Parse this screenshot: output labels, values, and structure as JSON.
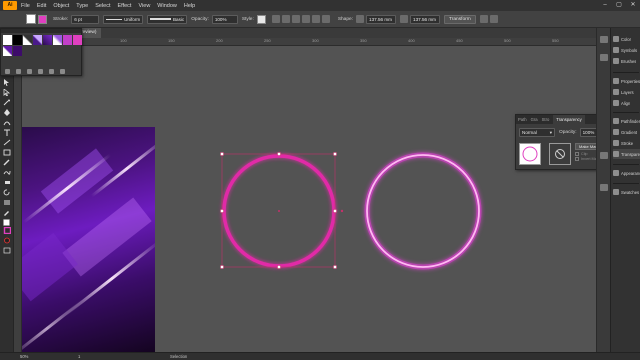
{
  "app": {
    "logo_text": "Ai"
  },
  "menu": {
    "items": [
      "File",
      "Edit",
      "Object",
      "Type",
      "Select",
      "Effect",
      "View",
      "Window",
      "Help"
    ],
    "window_controls": [
      "–",
      "▢",
      "✕"
    ]
  },
  "control_bar": {
    "stroke_label": "Stroke:",
    "stroke_weight": "6 pt",
    "profile": "Uniform",
    "brush": "Basic",
    "opacity_label": "Opacity:",
    "opacity_value": "100%",
    "style_label": "Style:",
    "shape_label": "Shape:",
    "width_value": "137.56 mm",
    "height_value": "137.56 mm",
    "transform_label": "Transform",
    "fill_color": "#ffffff",
    "stroke_color": "#e040c0"
  },
  "document_tab": {
    "label": "review)"
  },
  "ruler": {
    "top_ticks": [
      "0",
      "50",
      "100",
      "150",
      "200",
      "250",
      "300",
      "350",
      "400",
      "450",
      "500",
      "550"
    ]
  },
  "canvas": {
    "background": "#535353",
    "shape1_stroke": "#e12aa7",
    "shape2_stroke": "#ffb8f2",
    "glow_color": "#ff3cf0"
  },
  "transparency_panel": {
    "tabs": [
      "Path",
      "Gra",
      "Stro",
      "Transparency"
    ],
    "blend_mode": "Normal",
    "opacity_label": "Opacity:",
    "opacity_value": "100%",
    "make_mask_label": "Make Mask",
    "clip_label": "Clip",
    "invert_mask_label": "Invert Mask"
  },
  "right_dock": {
    "group1": [
      "Color",
      "Symbols",
      "Brushes"
    ],
    "group2": [
      "Properties",
      "Layers",
      "Align"
    ],
    "group3": [
      "Pathfinder",
      "Gradient",
      "Stroke",
      "Transparency"
    ],
    "group4": [
      "Appearance"
    ],
    "group5": [
      "Swatches"
    ]
  },
  "statusbar": {
    "zoom": "50%",
    "artboard": "1",
    "tool": "Selection"
  }
}
